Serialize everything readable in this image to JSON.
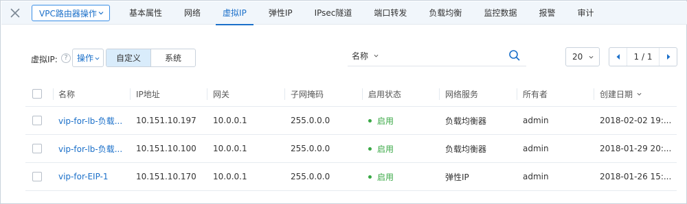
{
  "colors": {
    "accent": "#1a6fc9",
    "enabled": "#39a845",
    "topbar_bg": "#f1f6fb",
    "segment_active_bg": "#d9ecfb"
  },
  "topbar": {
    "close_icon": "close-icon",
    "router_ops_label": "VPC路由器操作",
    "tabs": [
      {
        "label": "基本属性",
        "active": false
      },
      {
        "label": "网络",
        "active": false
      },
      {
        "label": "虚拟IP",
        "active": true
      },
      {
        "label": "弹性IP",
        "active": false
      },
      {
        "label": "IPsec隧道",
        "active": false
      },
      {
        "label": "端口转发",
        "active": false
      },
      {
        "label": "负载均衡",
        "active": false
      },
      {
        "label": "监控数据",
        "active": false
      },
      {
        "label": "报警",
        "active": false
      },
      {
        "label": "审计",
        "active": false
      }
    ]
  },
  "toolbar": {
    "vip_label": "虚拟IP:",
    "help_icon": "?",
    "ops_label": "操作",
    "segments": [
      {
        "label": "自定义",
        "active": true
      },
      {
        "label": "系统",
        "active": false
      }
    ],
    "search_field_label": "名称",
    "search_value": "",
    "page_size": "20",
    "page_text": "1 / 1"
  },
  "table": {
    "headers": [
      "名称",
      "IP地址",
      "网关",
      "子网掩码",
      "启用状态",
      "网络服务",
      "所有者",
      "创建日期"
    ],
    "rows": [
      [
        "vip-for-lb-负载...",
        "10.151.10.197",
        "10.0.0.1",
        "255.0.0.0",
        "启用",
        "负载均衡器",
        "admin",
        "2018-02-02 19:..."
      ],
      [
        "vip-for-lb-负载...",
        "10.151.10.100",
        "10.0.0.1",
        "255.0.0.0",
        "启用",
        "负载均衡器",
        "admin",
        "2018-01-29 20:..."
      ],
      [
        "vip-for-EIP-1",
        "10.151.10.170",
        "10.0.0.1",
        "255.0.0.0",
        "启用",
        "弹性IP",
        "admin",
        "2018-01-26 15:..."
      ]
    ]
  }
}
